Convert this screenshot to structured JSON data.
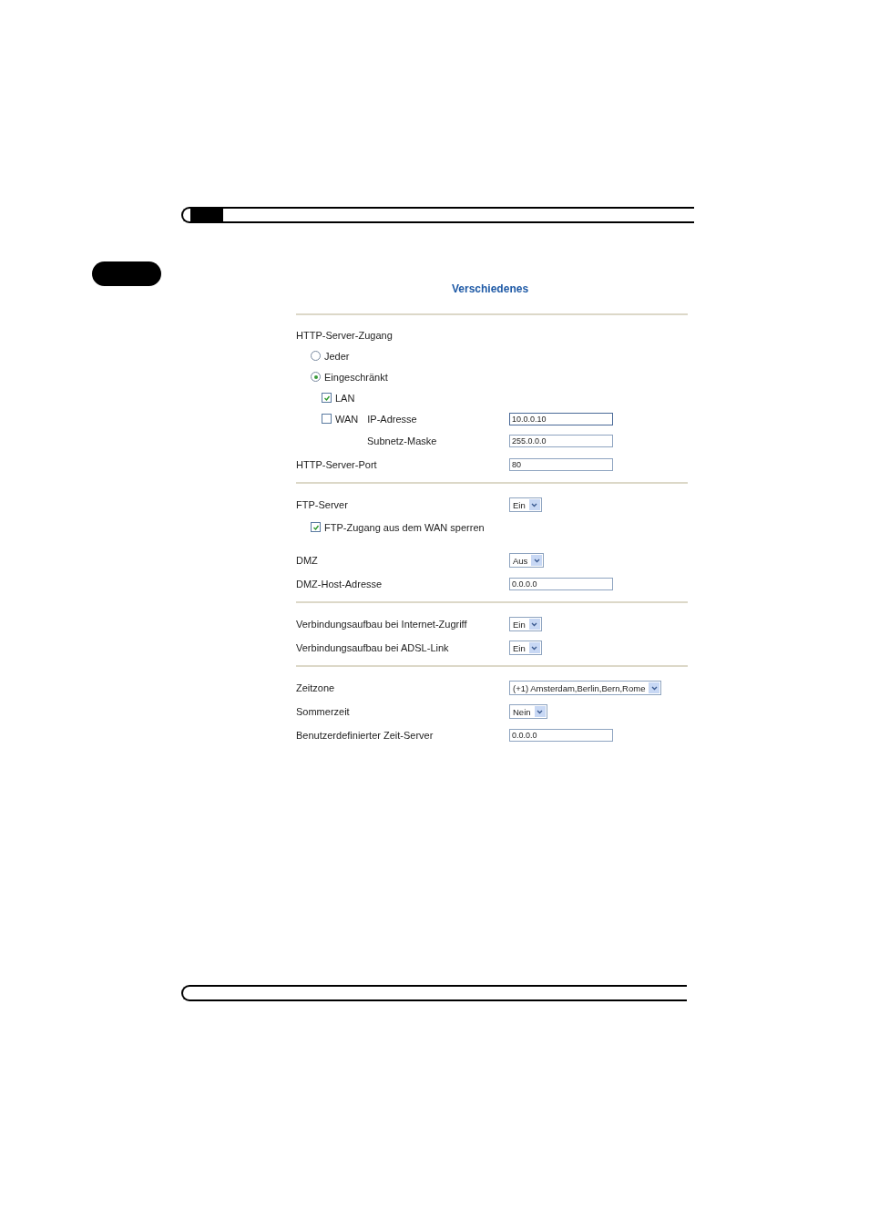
{
  "title": "Verschiedenes",
  "sections": [
    {
      "rows": [
        {
          "kind": "heading",
          "label": "HTTP-Server-Zugang"
        },
        {
          "kind": "radio",
          "label": "Jeder",
          "selected": false
        },
        {
          "kind": "radio",
          "label": "Eingeschränkt",
          "selected": true,
          "children": [
            {
              "kind": "checkbox",
              "label": "LAN",
              "checked": true
            },
            {
              "kind": "checkbox",
              "label": "WAN",
              "checked": false,
              "field_label": "IP-Adresse",
              "value": "10.0.0.10",
              "focused": true,
              "children": [
                {
                  "kind": "subfield",
                  "label": "Subnetz-Maske",
                  "value": "255.0.0.0"
                }
              ]
            }
          ]
        },
        {
          "kind": "text",
          "label": "HTTP-Server-Port",
          "value": "80"
        }
      ]
    },
    {
      "rows": [
        {
          "kind": "select",
          "label": "FTP-Server",
          "value": "Ein"
        },
        {
          "kind": "checkbox",
          "label": "FTP-Zugang aus dem WAN sperren",
          "checked": true
        },
        {
          "kind": "select",
          "label": "DMZ",
          "value": "Aus"
        },
        {
          "kind": "text",
          "label": "DMZ-Host-Adresse",
          "value": "0.0.0.0"
        }
      ]
    },
    {
      "rows": [
        {
          "kind": "select",
          "label": "Verbindungsaufbau bei Internet-Zugriff",
          "value": "Ein"
        },
        {
          "kind": "select",
          "label": "Verbindungsaufbau bei ADSL-Link",
          "value": "Ein"
        }
      ]
    },
    {
      "rows": [
        {
          "kind": "select",
          "label": "Zeitzone",
          "value": "(+1) Amsterdam,Berlin,Bern,Rome"
        },
        {
          "kind": "select",
          "label": "Sommerzeit",
          "value": "Nein"
        },
        {
          "kind": "text",
          "label": "Benutzerdefinierter Zeit-Server",
          "value": "0.0.0.0"
        }
      ]
    }
  ]
}
